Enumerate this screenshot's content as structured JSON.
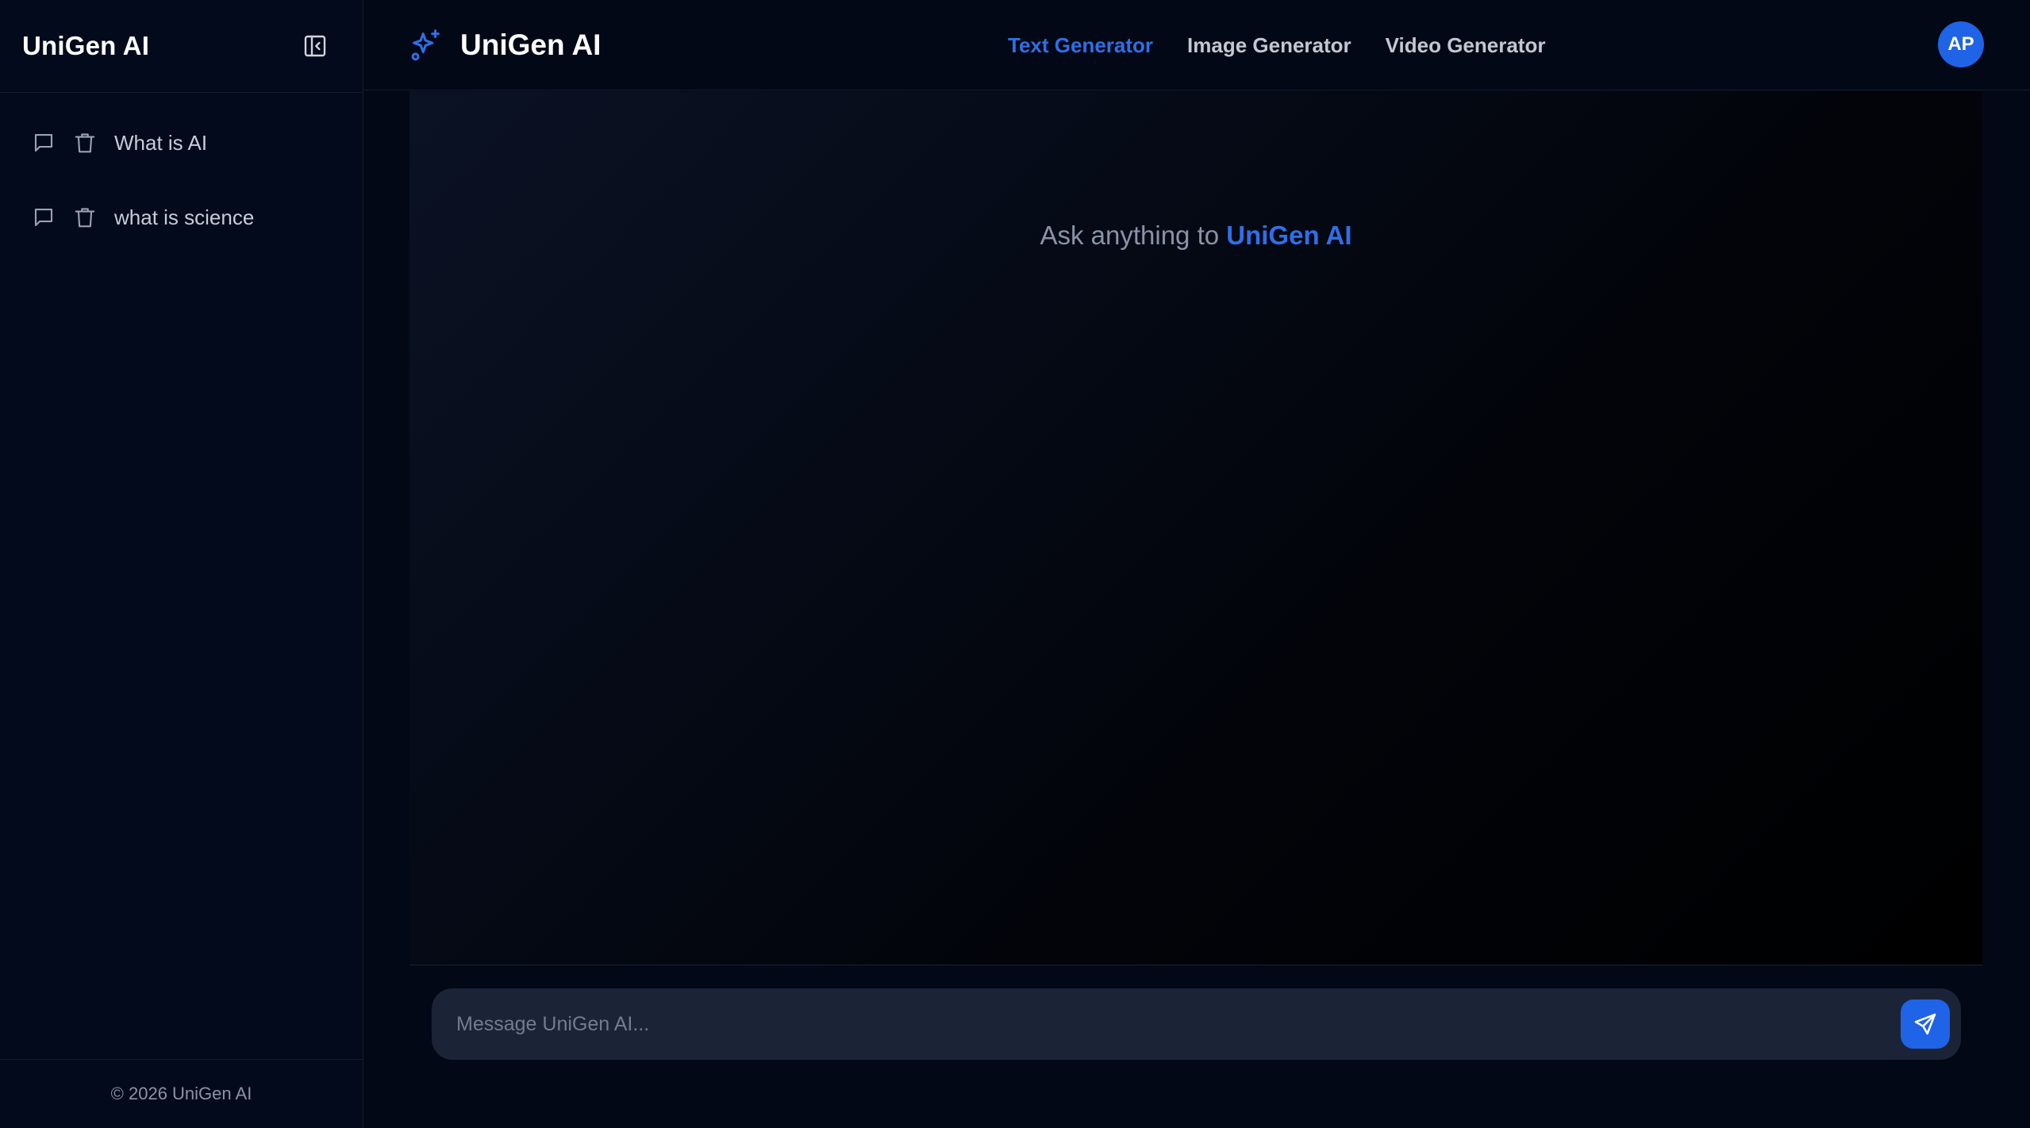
{
  "sidebar": {
    "title": "UniGen AI",
    "history": [
      {
        "label": "What is AI"
      },
      {
        "label": "what is science"
      }
    ],
    "footer": "© 2026 UniGen AI"
  },
  "header": {
    "brand": "UniGen AI",
    "nav": [
      {
        "label": "Text Generator",
        "active": true
      },
      {
        "label": "Image Generator",
        "active": false
      },
      {
        "label": "Video Generator",
        "active": false
      }
    ],
    "avatar_initials": "AP"
  },
  "chat": {
    "prompt_prefix": "Ask anything to",
    "prompt_accent": "UniGen AI"
  },
  "composer": {
    "placeholder": "Message UniGen AI...",
    "value": ""
  },
  "icons": {
    "collapse": "sidebar-collapse-icon",
    "chat": "chat-bubble-icon",
    "delete": "trash-icon",
    "brand": "sparkles-icon",
    "send": "send-icon"
  },
  "colors": {
    "accent": "#2f6fe6",
    "avatar": "#1f63e6",
    "background": "#030816",
    "composer": "#1b2436"
  }
}
